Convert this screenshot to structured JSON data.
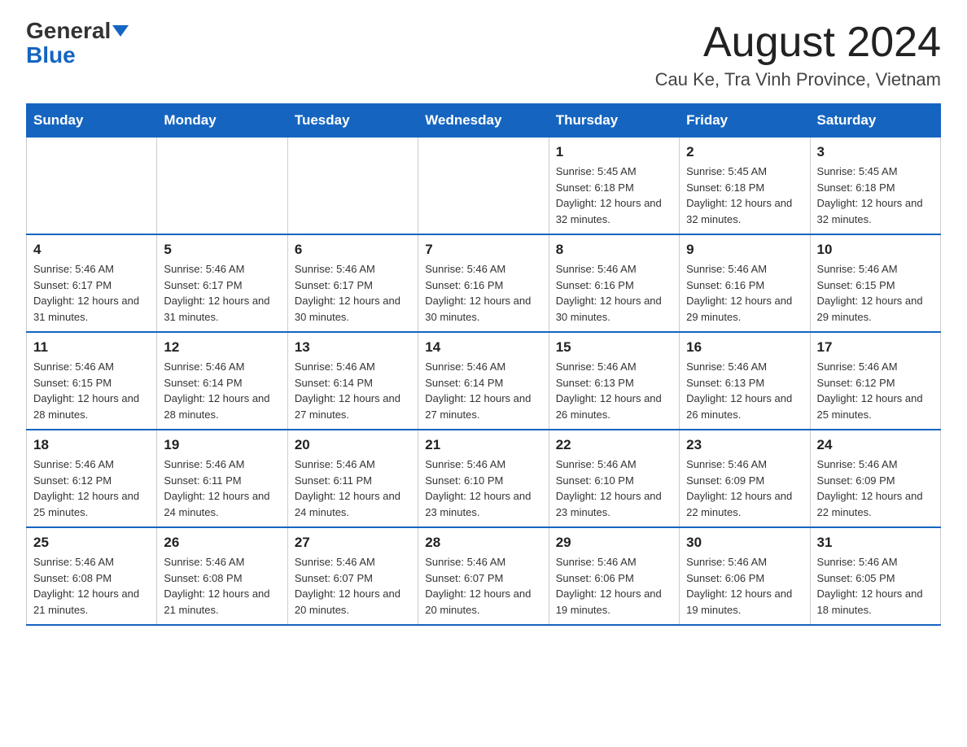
{
  "header": {
    "logo_general": "General",
    "logo_blue": "Blue",
    "main_title": "August 2024",
    "subtitle": "Cau Ke, Tra Vinh Province, Vietnam"
  },
  "days_of_week": [
    "Sunday",
    "Monday",
    "Tuesday",
    "Wednesday",
    "Thursday",
    "Friday",
    "Saturday"
  ],
  "weeks": [
    [
      {
        "day": "",
        "info": ""
      },
      {
        "day": "",
        "info": ""
      },
      {
        "day": "",
        "info": ""
      },
      {
        "day": "",
        "info": ""
      },
      {
        "day": "1",
        "info": "Sunrise: 5:45 AM\nSunset: 6:18 PM\nDaylight: 12 hours and 32 minutes."
      },
      {
        "day": "2",
        "info": "Sunrise: 5:45 AM\nSunset: 6:18 PM\nDaylight: 12 hours and 32 minutes."
      },
      {
        "day": "3",
        "info": "Sunrise: 5:45 AM\nSunset: 6:18 PM\nDaylight: 12 hours and 32 minutes."
      }
    ],
    [
      {
        "day": "4",
        "info": "Sunrise: 5:46 AM\nSunset: 6:17 PM\nDaylight: 12 hours and 31 minutes."
      },
      {
        "day": "5",
        "info": "Sunrise: 5:46 AM\nSunset: 6:17 PM\nDaylight: 12 hours and 31 minutes."
      },
      {
        "day": "6",
        "info": "Sunrise: 5:46 AM\nSunset: 6:17 PM\nDaylight: 12 hours and 30 minutes."
      },
      {
        "day": "7",
        "info": "Sunrise: 5:46 AM\nSunset: 6:16 PM\nDaylight: 12 hours and 30 minutes."
      },
      {
        "day": "8",
        "info": "Sunrise: 5:46 AM\nSunset: 6:16 PM\nDaylight: 12 hours and 30 minutes."
      },
      {
        "day": "9",
        "info": "Sunrise: 5:46 AM\nSunset: 6:16 PM\nDaylight: 12 hours and 29 minutes."
      },
      {
        "day": "10",
        "info": "Sunrise: 5:46 AM\nSunset: 6:15 PM\nDaylight: 12 hours and 29 minutes."
      }
    ],
    [
      {
        "day": "11",
        "info": "Sunrise: 5:46 AM\nSunset: 6:15 PM\nDaylight: 12 hours and 28 minutes."
      },
      {
        "day": "12",
        "info": "Sunrise: 5:46 AM\nSunset: 6:14 PM\nDaylight: 12 hours and 28 minutes."
      },
      {
        "day": "13",
        "info": "Sunrise: 5:46 AM\nSunset: 6:14 PM\nDaylight: 12 hours and 27 minutes."
      },
      {
        "day": "14",
        "info": "Sunrise: 5:46 AM\nSunset: 6:14 PM\nDaylight: 12 hours and 27 minutes."
      },
      {
        "day": "15",
        "info": "Sunrise: 5:46 AM\nSunset: 6:13 PM\nDaylight: 12 hours and 26 minutes."
      },
      {
        "day": "16",
        "info": "Sunrise: 5:46 AM\nSunset: 6:13 PM\nDaylight: 12 hours and 26 minutes."
      },
      {
        "day": "17",
        "info": "Sunrise: 5:46 AM\nSunset: 6:12 PM\nDaylight: 12 hours and 25 minutes."
      }
    ],
    [
      {
        "day": "18",
        "info": "Sunrise: 5:46 AM\nSunset: 6:12 PM\nDaylight: 12 hours and 25 minutes."
      },
      {
        "day": "19",
        "info": "Sunrise: 5:46 AM\nSunset: 6:11 PM\nDaylight: 12 hours and 24 minutes."
      },
      {
        "day": "20",
        "info": "Sunrise: 5:46 AM\nSunset: 6:11 PM\nDaylight: 12 hours and 24 minutes."
      },
      {
        "day": "21",
        "info": "Sunrise: 5:46 AM\nSunset: 6:10 PM\nDaylight: 12 hours and 23 minutes."
      },
      {
        "day": "22",
        "info": "Sunrise: 5:46 AM\nSunset: 6:10 PM\nDaylight: 12 hours and 23 minutes."
      },
      {
        "day": "23",
        "info": "Sunrise: 5:46 AM\nSunset: 6:09 PM\nDaylight: 12 hours and 22 minutes."
      },
      {
        "day": "24",
        "info": "Sunrise: 5:46 AM\nSunset: 6:09 PM\nDaylight: 12 hours and 22 minutes."
      }
    ],
    [
      {
        "day": "25",
        "info": "Sunrise: 5:46 AM\nSunset: 6:08 PM\nDaylight: 12 hours and 21 minutes."
      },
      {
        "day": "26",
        "info": "Sunrise: 5:46 AM\nSunset: 6:08 PM\nDaylight: 12 hours and 21 minutes."
      },
      {
        "day": "27",
        "info": "Sunrise: 5:46 AM\nSunset: 6:07 PM\nDaylight: 12 hours and 20 minutes."
      },
      {
        "day": "28",
        "info": "Sunrise: 5:46 AM\nSunset: 6:07 PM\nDaylight: 12 hours and 20 minutes."
      },
      {
        "day": "29",
        "info": "Sunrise: 5:46 AM\nSunset: 6:06 PM\nDaylight: 12 hours and 19 minutes."
      },
      {
        "day": "30",
        "info": "Sunrise: 5:46 AM\nSunset: 6:06 PM\nDaylight: 12 hours and 19 minutes."
      },
      {
        "day": "31",
        "info": "Sunrise: 5:46 AM\nSunset: 6:05 PM\nDaylight: 12 hours and 18 minutes."
      }
    ]
  ]
}
